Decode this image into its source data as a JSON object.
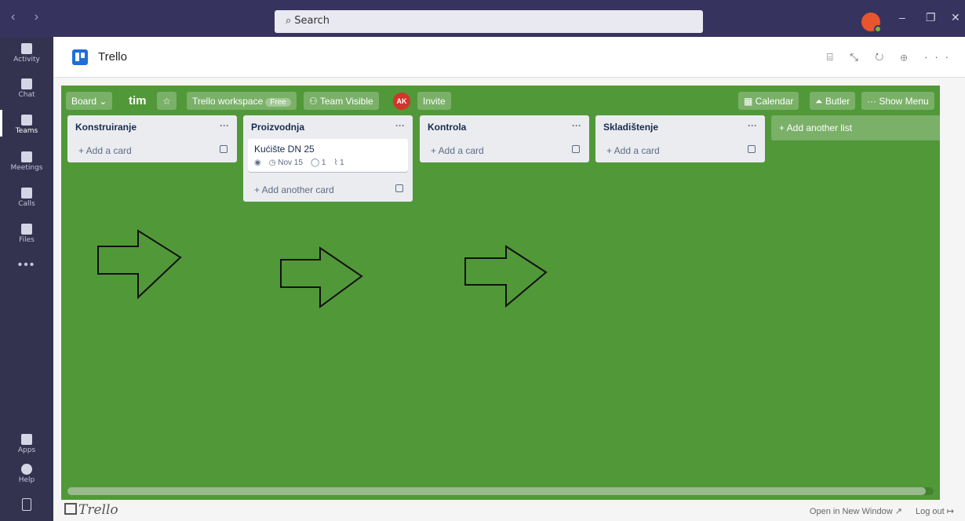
{
  "titlebar": {
    "back_label": "‹",
    "forward_label": "›",
    "search_placeholder": "Search",
    "minimize": "–",
    "maximize": "❐",
    "close": "✕"
  },
  "rail": {
    "items": [
      {
        "label": "Activity"
      },
      {
        "label": "Chat"
      },
      {
        "label": "Teams"
      },
      {
        "label": "Meetings"
      },
      {
        "label": "Calls"
      },
      {
        "label": "Files"
      }
    ],
    "more": "•••",
    "apps": "Apps",
    "help": "Help"
  },
  "app": {
    "title": "Trello",
    "head_icons": "⌸ ⤡ ↻ ⊕ ···"
  },
  "board": {
    "view_label": "Board",
    "name": "tim",
    "star": "☆",
    "workspace": "Trello workspace",
    "workspace_tag": "Free",
    "visibility": "Team Visible",
    "member_initials": "AK",
    "invite": "Invite",
    "calendar": "Calendar",
    "butler": "Butler",
    "show_menu": "Show Menu",
    "lists": [
      {
        "title": "Konstruiranje",
        "add_label": "+ Add a card"
      },
      {
        "title": "Proizvodnja",
        "add_label": "+ Add another card",
        "card": {
          "title": "Kućište DN 25",
          "due": "Nov 15",
          "comments": "1",
          "attachments": "1"
        }
      },
      {
        "title": "Kontrola",
        "add_label": "+ Add a card"
      },
      {
        "title": "Skladištenje",
        "add_label": "+ Add a card"
      }
    ],
    "add_list": "+ Add another list"
  },
  "footer": {
    "logo": "Trello",
    "open_new": "Open in New Window ↗",
    "logout": "Log out ↦"
  },
  "colors": {
    "board_bg": "#519839",
    "titlebar": "#36335e",
    "rail": "#33324f"
  }
}
